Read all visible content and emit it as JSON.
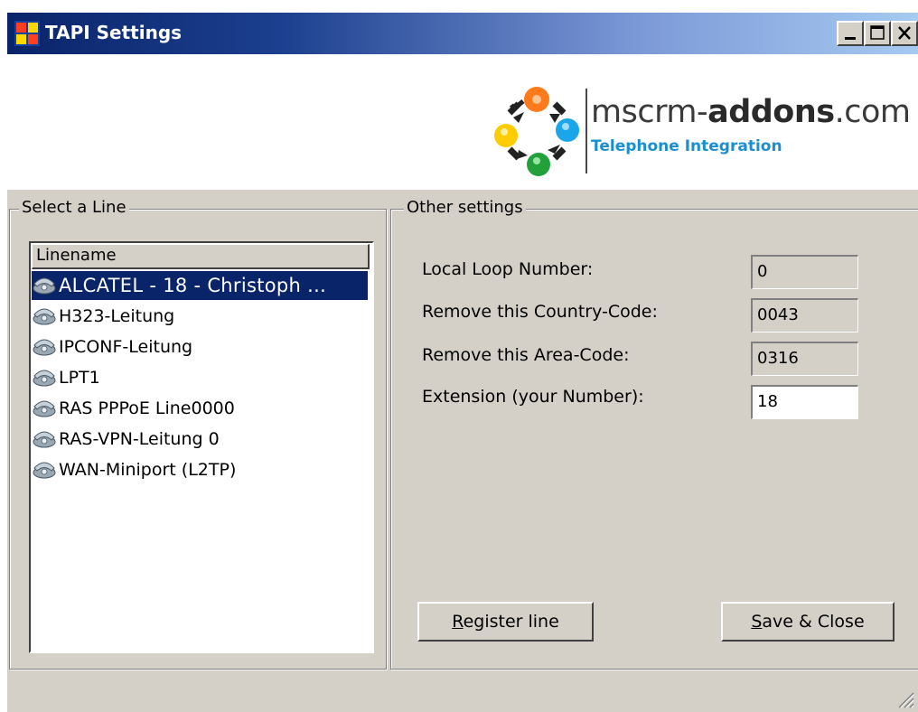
{
  "window": {
    "title": "TAPI Settings",
    "icon": "app-icon",
    "controls": [
      "minimize-icon",
      "maximize-icon",
      "close-icon"
    ]
  },
  "logo": {
    "brand_prefix": "mscrm-",
    "brand_bold": "addons",
    "brand_suffix": ".com",
    "tagline": "Telephone Integration"
  },
  "select_line": {
    "legend": "Select a Line",
    "column_header": "Linename",
    "items": [
      {
        "label": "ALCATEL - 18 - Christoph ...",
        "selected": true,
        "icon": "telephone-icon"
      },
      {
        "label": "H323-Leitung",
        "selected": false,
        "icon": "telephone-icon"
      },
      {
        "label": "IPCONF-Leitung",
        "selected": false,
        "icon": "telephone-icon"
      },
      {
        "label": "LPT1",
        "selected": false,
        "icon": "telephone-icon"
      },
      {
        "label": "RAS PPPoE Line0000",
        "selected": false,
        "icon": "telephone-icon"
      },
      {
        "label": "RAS-VPN-Leitung 0",
        "selected": false,
        "icon": "telephone-icon"
      },
      {
        "label": "WAN-Miniport (L2TP)",
        "selected": false,
        "icon": "telephone-icon"
      }
    ]
  },
  "other_settings": {
    "legend": "Other settings",
    "local_loop": {
      "label": "Local Loop Number:",
      "value": "0"
    },
    "country_code": {
      "label": "Remove this Country-Code:",
      "value": "0043"
    },
    "area_code": {
      "label": "Remove this Area-Code:",
      "value": "0316"
    },
    "extension": {
      "label": "Extension (your Number):",
      "value": "18"
    }
  },
  "buttons": {
    "register_mnemonic": "R",
    "register_rest": "egister line",
    "save_mnemonic": "S",
    "save_rest": "ave & Close"
  },
  "colors": {
    "selection": "#0a246a",
    "window_bg": "#d4d0c8",
    "tagline": "#1a8fd0"
  }
}
